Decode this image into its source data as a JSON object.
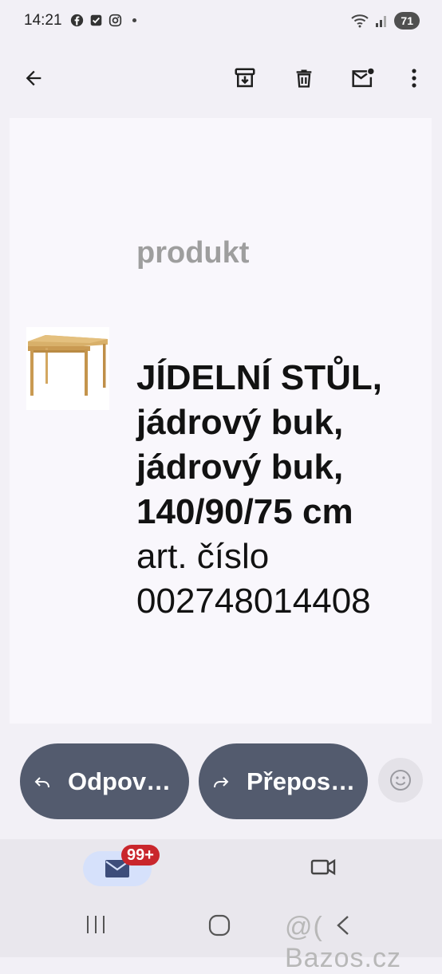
{
  "status_bar": {
    "time": "14:21",
    "battery": "71",
    "notification_icons": [
      "facebook-icon",
      "checkbox-icon",
      "instagram-icon",
      "dot-icon"
    ],
    "system_icons": [
      "wifi-icon",
      "signal-icon"
    ]
  },
  "toolbar": {
    "back_icon": "arrow-back-icon",
    "actions": [
      "archive-icon",
      "delete-icon",
      "mark-unread-icon",
      "more-vert-icon"
    ]
  },
  "email": {
    "heading": "produkt",
    "product_name": "JÍDELNÍ STŮL, jádrový buk, jádrový buk, 140/90/75 cm",
    "art_label": "art. číslo",
    "art_number": "002748014408"
  },
  "actions": {
    "reply_label": "Odpov…",
    "forward_label": "Přepos…"
  },
  "bottom_nav": {
    "mail_badge": "99+"
  },
  "watermark": "@( Bazos.cz",
  "colors": {
    "pill": "#535b6e",
    "badge": "#c9262c",
    "nav_active": "#d6e1fb",
    "background": "#f2f0f6"
  }
}
